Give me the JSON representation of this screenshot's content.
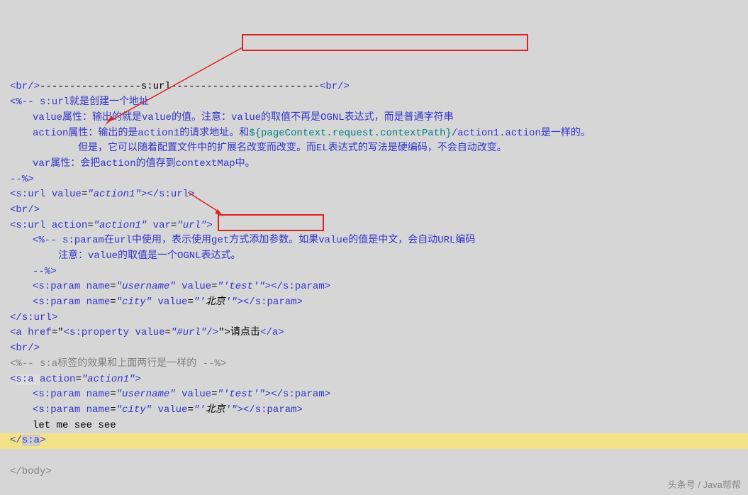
{
  "l1a": "<",
  "l1b": "br",
  "l1c": "/>",
  "l1d": "-----------------s:url-------------------------",
  "l1e": "<",
  "l1f": "br",
  "l1g": "/>",
  "c1": "<%-- s:url就是创建一个地址",
  "c2": "value属性：输出的就是value的值。注意：value的取值不再是OGNL表达式，而是普通字符串",
  "c3a": "action属性：输出的是action1的请求地址。和",
  "c3b": "${pageContext.request.contextPath}",
  "c3c": "/action1.action是一样的。",
  "c4": "但是，它可以随着配置文件中的扩展名改变而改变。而EL表达式的写法是硬编码，不会自动改变。",
  "c5": "var属性：会把action的值存到contextMap中。",
  "c6": "--%>",
  "u1a": "<",
  "u1b": "s:url ",
  "u1c": "value",
  "u1d": "=",
  "u1e": "\"action1\"",
  "u1f": ">",
  "u1g": "</",
  "u1h": "s:url",
  "u1i": ">",
  "br": "<",
  "brT": "br",
  "brE": "/>",
  "u2a": "<",
  "u2b": "s:url ",
  "u2c": "action",
  "u2d": "=",
  "u2e": "\"action1\" ",
  "u2f": "var",
  "u2g": "=",
  "u2h": "\"url\"",
  "u2i": ">",
  "p1": "<%-- s:param在url中使用，表示使用get方式添加参数。如果value的值是中文，会自动URL编码",
  "p2": "注意：value的取值是一个OGNL表达式。",
  "p3": "--%>",
  "sp1a": "<",
  "sp1b": "s:param ",
  "sp1c": "name",
  "sp1d": "=",
  "sp1e": "\"username\" ",
  "sp1f": "value",
  "sp1g": "=",
  "sp1h": "\"'test'\"",
  "sp1i": ">",
  "sp1j": "</",
  "sp1k": "s:param",
  "sp1l": ">",
  "sp2a": "<",
  "sp2b": "s:param ",
  "sp2c": "name",
  "sp2d": "=",
  "sp2e": "\"city\" ",
  "sp2f": "value",
  "sp2g": "=",
  "sp2h": "\"'",
  "sp2ch": "北京",
  "sp2he": "'\"",
  "sp2i": ">",
  "sp2j": "</",
  "sp2k": "s:param",
  "sp2l": ">",
  "cu": "</",
  "cuT": "s:url",
  "cuE": ">",
  "aa": "<",
  "ab": "a ",
  "ac": "href",
  "ad": "=\"",
  "ae": "<",
  "af": "s:property ",
  "ag": "value",
  "ah": "=",
  "ai": "\"#url\"",
  "aj": "/>",
  "ak": "\">",
  "al": "请点击",
  "am": "</",
  "an": "a",
  "ao": ">",
  "cm2": "<%-- s:a标签的效果和上面两行是一样的 --%>",
  "sa1": "<",
  "sa2": "s:a ",
  "sa3": "action",
  "sa4": "=",
  "sa5": "\"action1\"",
  "sa6": ">",
  "txt": "let me see see",
  "ce": "</",
  "ceT": "s:a",
  "ceE": ">",
  "bd": "</body>",
  "wm": "头条号 / Java帮帮"
}
